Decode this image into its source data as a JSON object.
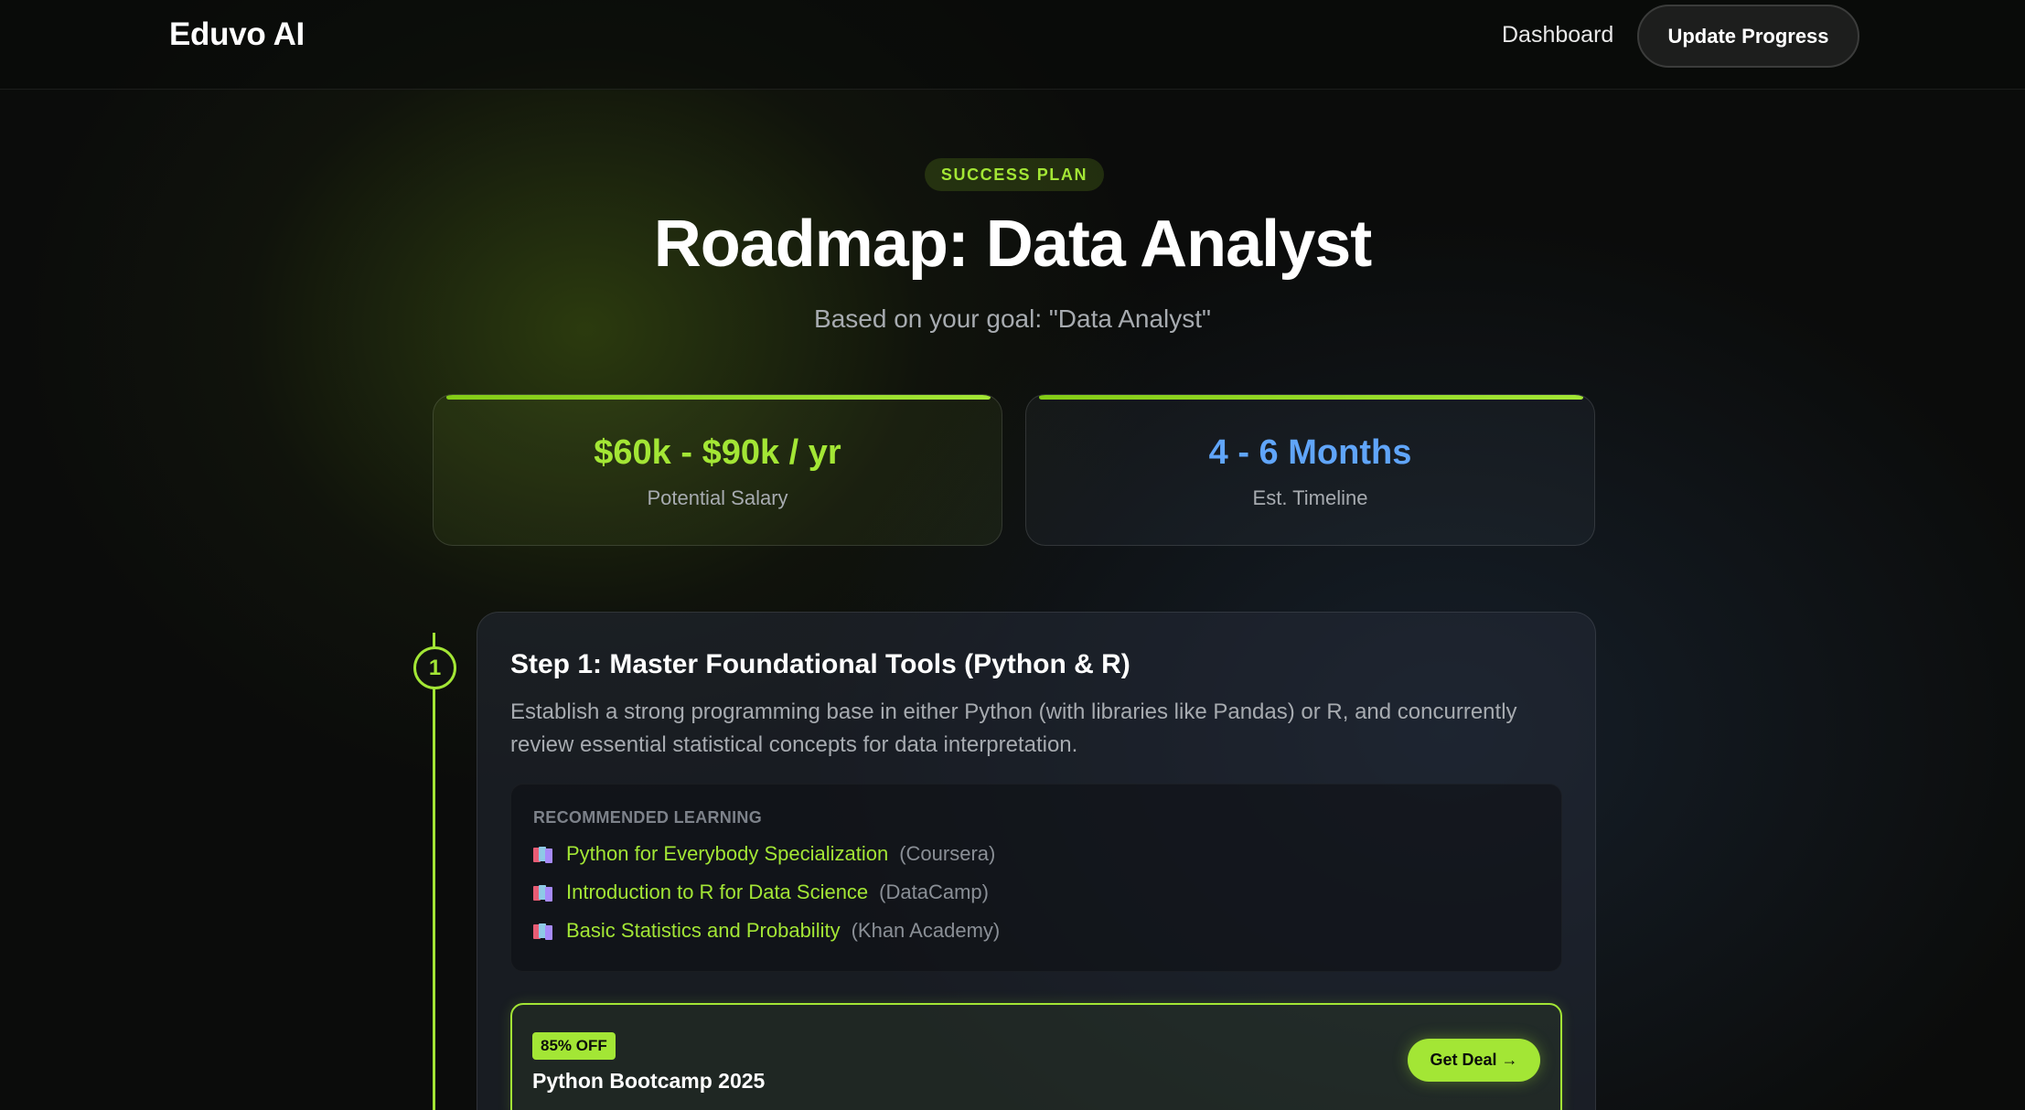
{
  "header": {
    "logo": "Eduvo AI",
    "nav_dashboard": "Dashboard",
    "update_button": "Update Progress"
  },
  "hero": {
    "badge": "SUCCESS PLAN",
    "title": "Roadmap: Data Analyst",
    "subtitle": "Based on your goal: \"Data Analyst\""
  },
  "stats": {
    "salary": {
      "value": "$60k - $90k / yr",
      "label": "Potential Salary",
      "color": "#a3e635"
    },
    "timeline": {
      "value": "4 - 6 Months",
      "label": "Est. Timeline",
      "color": "#60a5fa"
    }
  },
  "steps": [
    {
      "number": "1",
      "title": "Step 1: Master Foundational Tools (Python & R)",
      "description": "Establish a strong programming base in either Python (with libraries like Pandas) or R, and concurrently review essential statistical concepts for data interpretation.",
      "learning_heading": "RECOMMENDED LEARNING",
      "learning_items": [
        {
          "icon": "books-icon",
          "title": "Python for Everybody Specialization",
          "provider": "(Coursera)"
        },
        {
          "icon": "books-icon",
          "title": "Introduction to R for Data Science",
          "provider": "(DataCamp)"
        },
        {
          "icon": "books-icon",
          "title": "Basic Statistics and Probability",
          "provider": "(Khan Academy)"
        }
      ],
      "deal": {
        "badge": "85% OFF",
        "title": "Python Bootcamp 2025",
        "button": "Get Deal →"
      }
    }
  ],
  "colors": {
    "accent": "#a3e635",
    "timeline_value": "#60a5fa",
    "background": "#0b0c0b"
  }
}
